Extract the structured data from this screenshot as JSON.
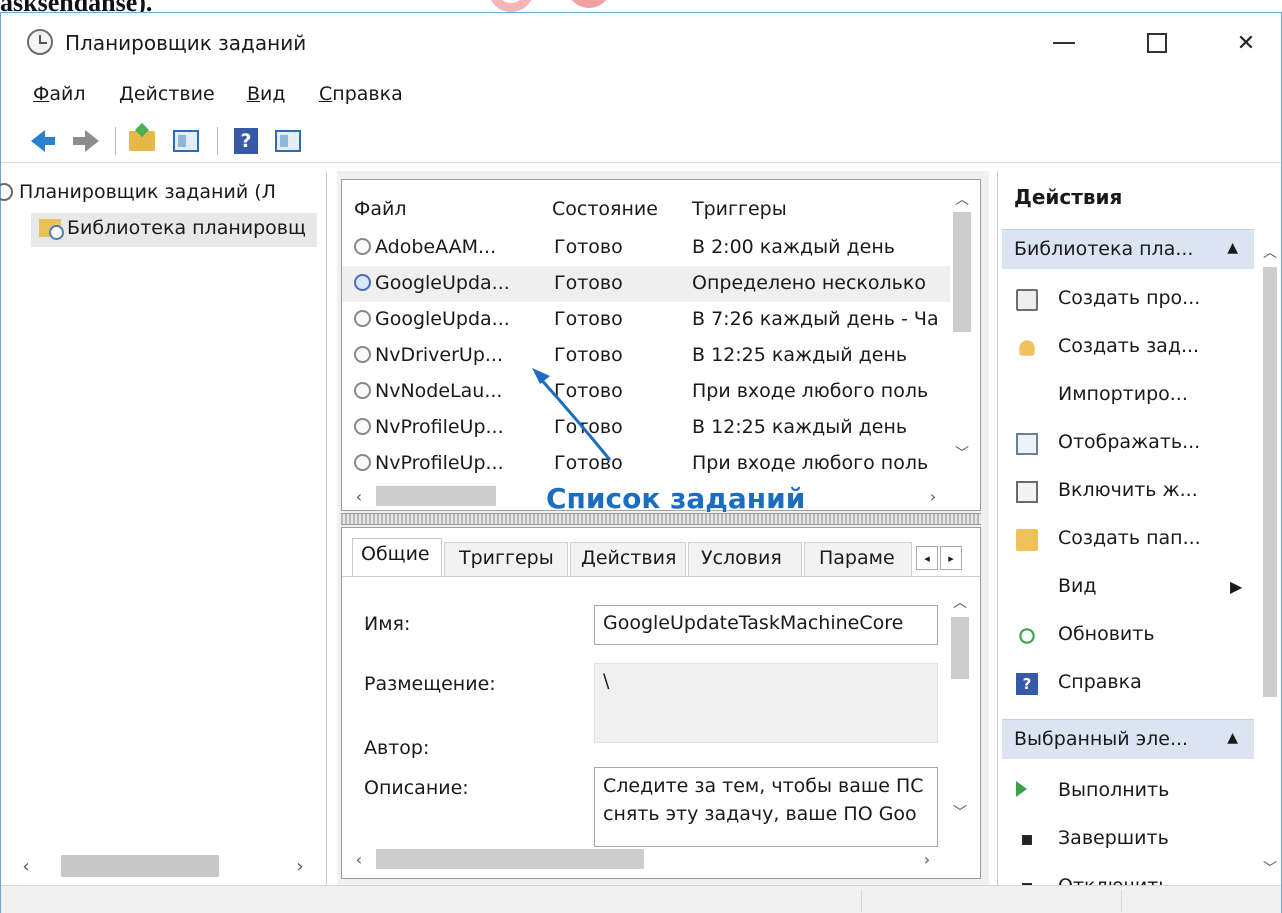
{
  "caption_fragment": "asksendanse).",
  "window": {
    "title": "Планировщик заданий"
  },
  "menu": {
    "items": [
      {
        "label": "Файл",
        "accel": "Ф",
        "rest": "айл"
      },
      {
        "label": "Действие",
        "accel": "Д",
        "rest": "ействие"
      },
      {
        "label": "Вид",
        "accel": "В",
        "rest": "ид"
      },
      {
        "label": "Справка",
        "accel": "С",
        "rest": "правка"
      }
    ]
  },
  "toolbar": {
    "icons": [
      "back-arrow-icon",
      "forward-arrow-icon",
      "up-folder-icon",
      "show-pane-icon",
      "help-icon",
      "action-pane-icon"
    ]
  },
  "tree": {
    "root": "Планировщик заданий (Л",
    "child": "Библиотека планировщ"
  },
  "tasks": {
    "columns": [
      "Файл",
      "Состояние",
      "Триггеры"
    ],
    "rows": [
      {
        "name": "AdobeAAM...",
        "status": "Готово",
        "trigger": "В 2:00 каждый день",
        "icon": "clock-icon",
        "selected": false
      },
      {
        "name": "GoogleUpda...",
        "status": "Готово",
        "trigger": "Определено несколько",
        "icon": "clock-icon",
        "selected": true
      },
      {
        "name": "GoogleUpda...",
        "status": "Готово",
        "trigger": "В 7:26 каждый день - Ча",
        "icon": "clock-icon",
        "selected": false
      },
      {
        "name": "NvDriverUp...",
        "status": "Готово",
        "trigger": "В 12:25 каждый день",
        "icon": "clock-icon",
        "selected": false
      },
      {
        "name": "NvNodeLau...",
        "status": "Готово",
        "trigger": "При входе любого поль",
        "icon": "clock-icon",
        "selected": false
      },
      {
        "name": "NvProfileUp...",
        "status": "Готово",
        "trigger": "В 12:25 каждый день",
        "icon": "clock-icon",
        "selected": false
      },
      {
        "name": "NvProfileUp...",
        "status": "Готово",
        "trigger": "При входе любого поль",
        "icon": "clock-icon",
        "selected": false
      }
    ],
    "annotation": "Список заданий"
  },
  "details": {
    "tabs": [
      "Общие",
      "Триггеры",
      "Действия",
      "Условия",
      "Параме"
    ],
    "active_tab": 0,
    "fields": {
      "name_label": "Имя:",
      "name_value": "GoogleUpdateTaskMachineCore",
      "location_label": "Размещение:",
      "location_value": "\\",
      "author_label": "Автор:",
      "description_label": "Описание:",
      "description_line1": "Следите за тем, чтобы ваше ПС",
      "description_line2": "снять эту задачу, ваше ПО Goo"
    }
  },
  "actions": {
    "title": "Действия",
    "group1": "Библиотека пла...",
    "items1": [
      {
        "label": "Создать про...",
        "icon": "task-icon"
      },
      {
        "label": "Создать зад...",
        "icon": "wizard-icon"
      },
      {
        "label": "Импортиро...",
        "icon": ""
      },
      {
        "label": "Отображать...",
        "icon": "running-tasks-icon"
      },
      {
        "label": "Включить ж...",
        "icon": "history-log-icon"
      },
      {
        "label": "Создать пап...",
        "icon": "folder-icon"
      },
      {
        "label": "Вид",
        "icon": ""
      },
      {
        "label": "Обновить",
        "icon": "refresh-icon"
      },
      {
        "label": "Справка",
        "icon": "help-icon"
      }
    ],
    "group2": "Выбранный эле...",
    "items2": [
      {
        "label": "Выполнить",
        "icon": "run-icon"
      },
      {
        "label": "Завершить",
        "icon": "stop-icon"
      },
      {
        "label": "Отключить",
        "icon": "disable-icon"
      }
    ]
  },
  "colors": {
    "accent": "#1b6dc1",
    "selection": "#efefef",
    "group_header": "#dbe5f1",
    "window_border": "#6fa7d4"
  }
}
